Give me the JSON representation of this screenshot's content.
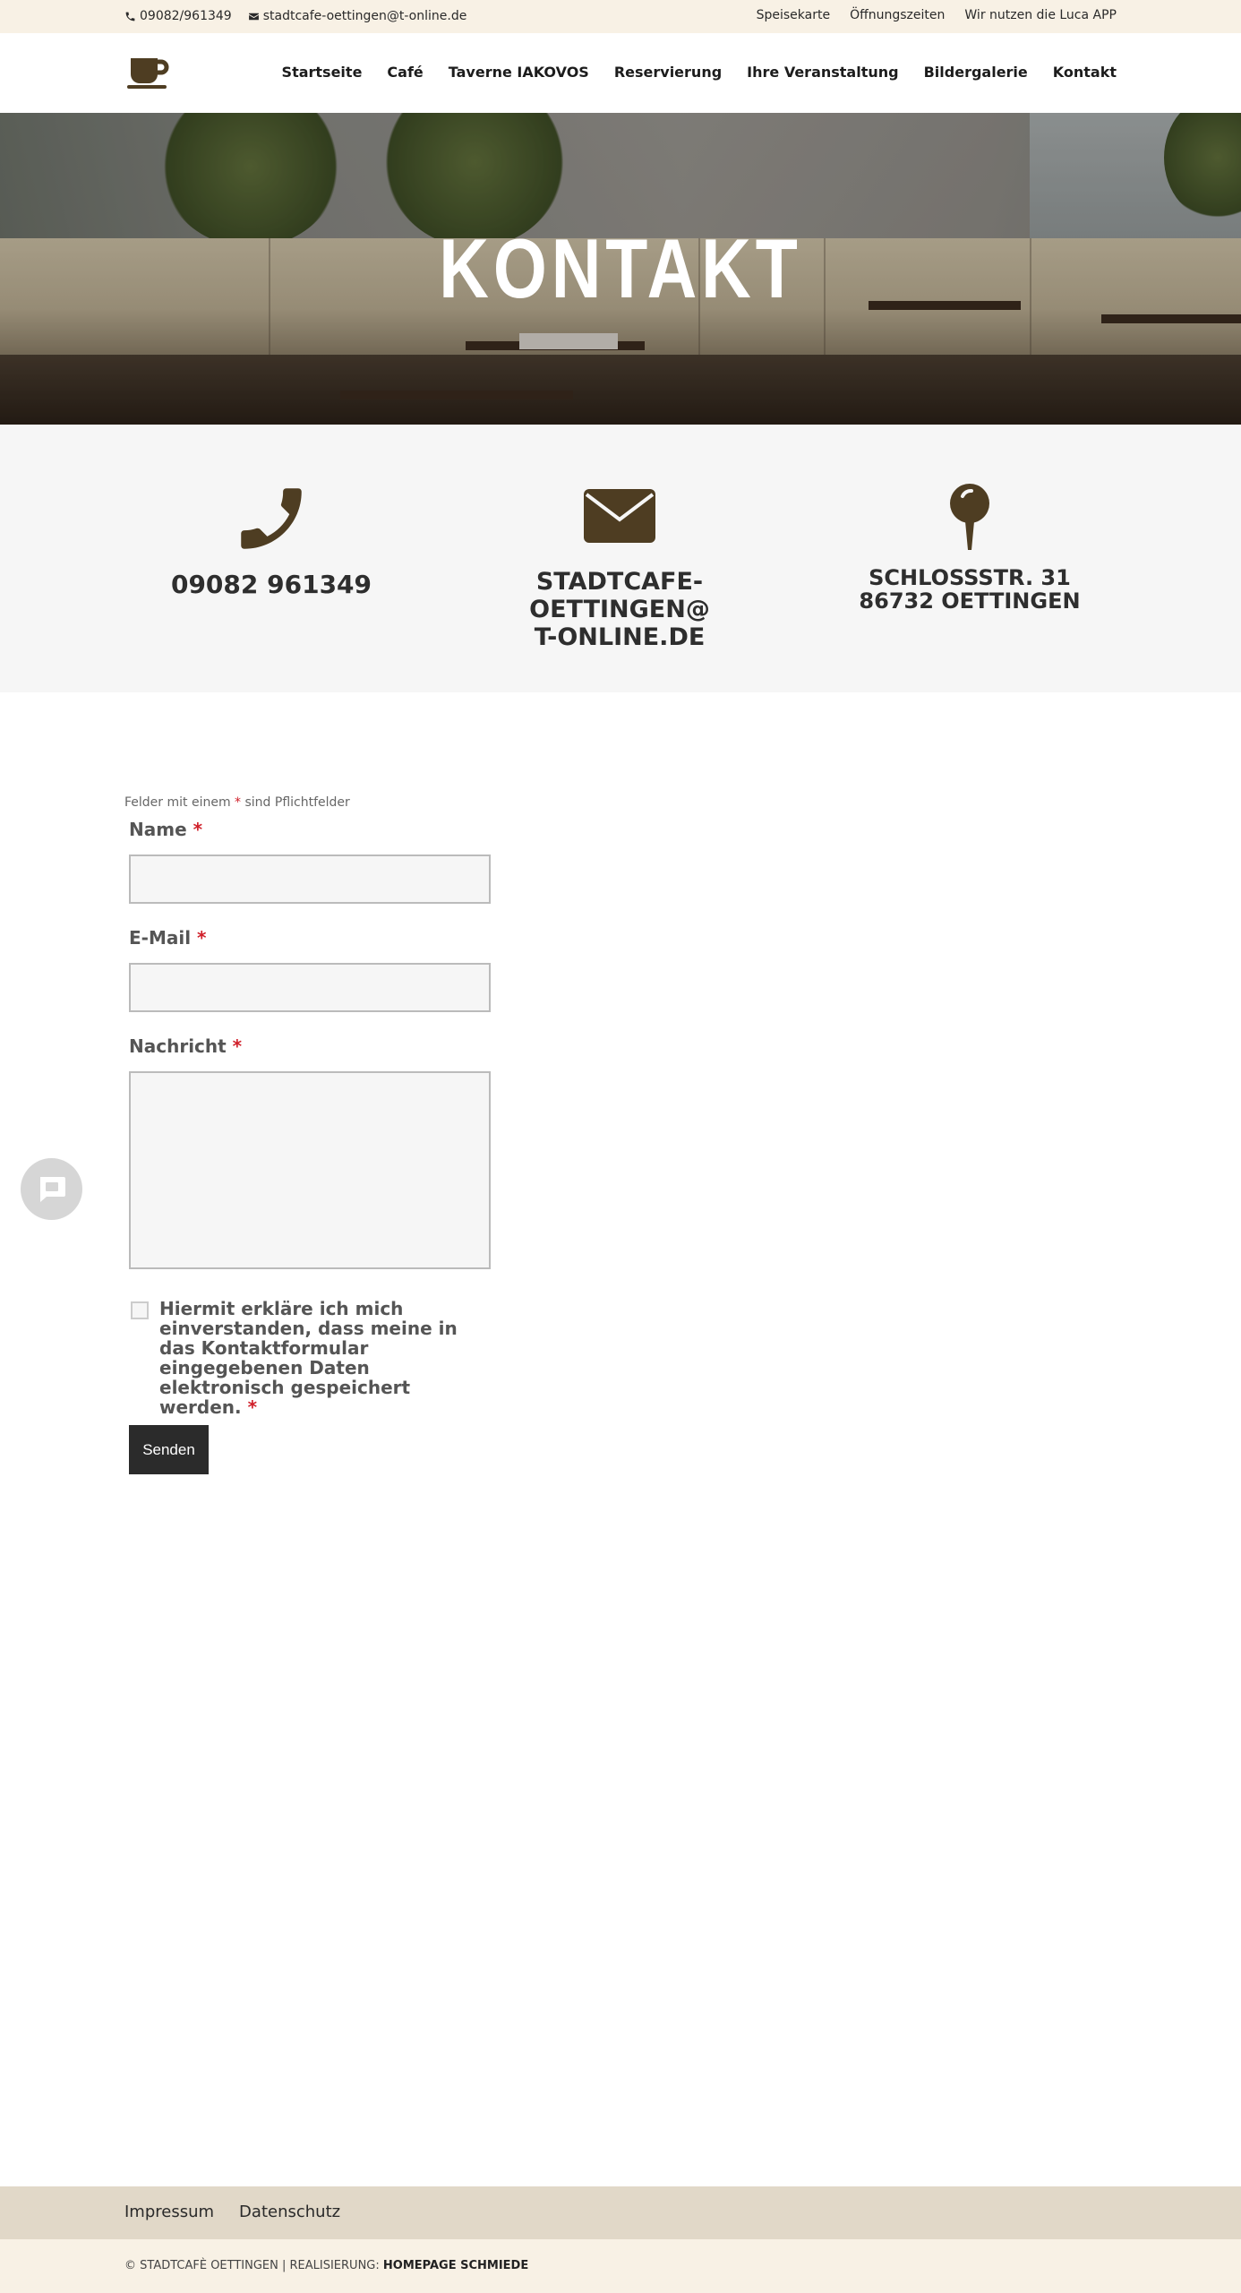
{
  "topbar": {
    "phone": "09082/961349",
    "email": "stadtcafe-oettingen@t-online.de",
    "links": [
      "Speisekarte",
      "Öffnungszeiten",
      "Wir nutzen die Luca APP"
    ]
  },
  "nav": {
    "items": [
      "Startseite",
      "Café",
      "Taverne IAKOVOS",
      "Reservierung",
      "Ihre Veranstaltung",
      "Bildergalerie",
      "Kontakt"
    ]
  },
  "hero": {
    "title": "KONTAKT"
  },
  "info": {
    "phone": "09082 961349",
    "email_line1": "STADTCAFE-OETTINGEN@",
    "email_line2": "T-ONLINE.DE",
    "address_line1": "SCHLOSSSTR. 31",
    "address_line2": "86732 OETTINGEN"
  },
  "form": {
    "required_note_pre": "Felder mit einem",
    "required_marker": "*",
    "required_note_post": "sind Pflichtfelder",
    "name_label": "Name",
    "email_label": "E-Mail",
    "message_label": "Nachricht",
    "name_value": "",
    "email_value": "",
    "message_value": "",
    "consent_text": "Hiermit erkläre ich mich einverstanden, dass meine in das Kontaktformular eingegebenen Daten elektronisch gespeichert werden.",
    "consent_checked": false,
    "submit_label": "Senden"
  },
  "footer": {
    "links": [
      "Impressum",
      "Datenschutz"
    ],
    "copyright_pre": "© STADTCAFÈ OETTINGEN | REALISIERUNG:",
    "copyright_brand": "HOMEPAGE SCHMIEDE"
  },
  "colors": {
    "brand_brown": "#4e3d22",
    "topbar_bg": "#f8f1e5",
    "footer_nav_bg": "#e1d8c8",
    "required_red": "#d0202a",
    "button_dark": "#2b2b2b"
  },
  "icons": {
    "topbar_phone": "phone-icon",
    "topbar_email": "envelope-icon",
    "logo": "coffee-cup-icon",
    "info_phone": "phone-icon",
    "info_email": "envelope-icon",
    "info_address": "map-pin-icon",
    "chat": "chat-bubble-icon"
  }
}
